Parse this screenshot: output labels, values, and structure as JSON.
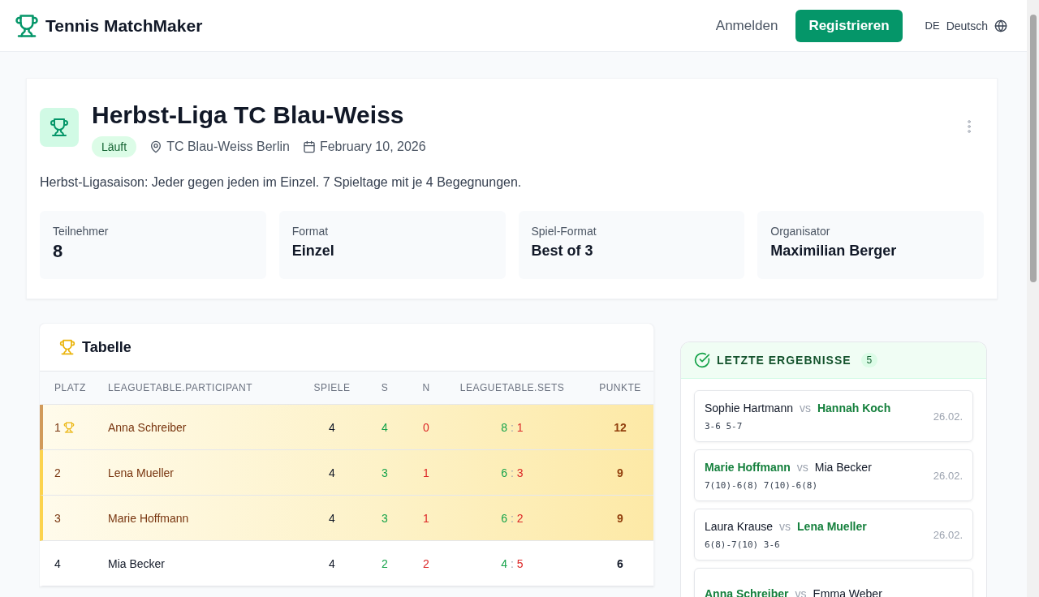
{
  "header": {
    "brand": "Tennis MatchMaker",
    "login": "Anmelden",
    "register": "Registrieren",
    "language_code": "DE",
    "language": "Deutsch"
  },
  "tournament": {
    "title": "Herbst-Liga TC Blau-Weiss",
    "status": "Läuft",
    "location": "TC Blau-Weiss Berlin",
    "date": "February 10, 2026",
    "description": "Herbst-Ligasaison: Jeder gegen jeden im Einzel. 7 Spieltage mit je 4 Begegnungen.",
    "stats": [
      {
        "label": "Teilnehmer",
        "value": "8",
        "kind": "number"
      },
      {
        "label": "Format",
        "value": "Einzel",
        "kind": "text"
      },
      {
        "label": "Spiel-Format",
        "value": "Best of 3",
        "kind": "text"
      },
      {
        "label": "Organisator",
        "value": "Maximilian Berger",
        "kind": "text"
      }
    ]
  },
  "league_table": {
    "title": "Tabelle",
    "columns": [
      "PLATZ",
      "LEAGUETABLE.PARTICIPANT",
      "SPIELE",
      "S",
      "N",
      "LEAGUETABLE.SETS",
      "PUNKTE"
    ],
    "rows": [
      {
        "rank": "1",
        "leader": true,
        "highlighted": true,
        "participant": "Anna Schreiber",
        "played": "4",
        "won": "4",
        "lost": "0",
        "sets_won": "8",
        "sets_separator": ":",
        "sets_lost": "1",
        "points": "12"
      },
      {
        "rank": "2",
        "leader": false,
        "highlighted": true,
        "participant": "Lena Mueller",
        "played": "4",
        "won": "3",
        "lost": "1",
        "sets_won": "6",
        "sets_separator": ":",
        "sets_lost": "3",
        "points": "9"
      },
      {
        "rank": "3",
        "leader": false,
        "highlighted": true,
        "participant": "Marie Hoffmann",
        "played": "4",
        "won": "3",
        "lost": "1",
        "sets_won": "6",
        "sets_separator": ":",
        "sets_lost": "2",
        "points": "9"
      },
      {
        "rank": "4",
        "leader": false,
        "highlighted": false,
        "participant": "Mia Becker",
        "played": "4",
        "won": "2",
        "lost": "2",
        "sets_won": "4",
        "sets_separator": ":",
        "sets_lost": "5",
        "points": "6"
      }
    ]
  },
  "recent_results": {
    "title": "LETZTE ERGEBNISSE",
    "count": "5",
    "matches": [
      {
        "player_a": {
          "name": "Sophie Hartmann",
          "winner": false
        },
        "vs": "vs",
        "player_b": {
          "name": "Hannah Koch",
          "winner": true
        },
        "score": "3-6 5-7",
        "date": "26.02."
      },
      {
        "player_a": {
          "name": "Marie Hoffmann",
          "winner": true
        },
        "vs": "vs",
        "player_b": {
          "name": "Mia Becker",
          "winner": false
        },
        "score": "7(10)-6(8) 7(10)-6(8)",
        "date": "26.02."
      },
      {
        "player_a": {
          "name": "Laura Krause",
          "winner": false
        },
        "vs": "vs",
        "player_b": {
          "name": "Lena Mueller",
          "winner": true
        },
        "score": "6(8)-7(10) 3-6",
        "date": "26.02."
      },
      {
        "player_a": {
          "name": "Anna Schreiber",
          "winner": true
        },
        "vs": "vs",
        "player_b": {
          "name": "Emma Weber",
          "winner": false
        }
      }
    ]
  }
}
